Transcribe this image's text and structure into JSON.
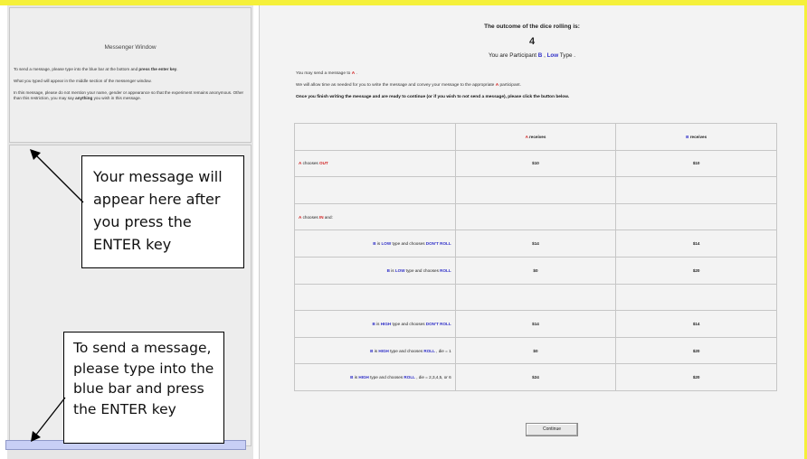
{
  "messenger": {
    "title": "Messenger Window",
    "line1_pre": "To send a message, please type into the blue bar at the bottom and ",
    "line1_bold": "press the enter key",
    "line1_post": ".",
    "line2": "What you typed will appear in the middle section of the messenger window.",
    "line3_pre": "In this message, please do not mention your name, gender or appearance so that the experiment remains anonymous. Other than this restriction, you may say ",
    "line3_bold": "anything",
    "line3_post": " you wish in this message.",
    "input_value": ""
  },
  "callouts": {
    "top_lines": [
      "Your message will",
      "appear here after",
      "you press the",
      "ENTER key"
    ],
    "bottom_lines": [
      "To send a message,",
      "please type into the",
      "blue bar and press",
      "the ENTER key"
    ]
  },
  "outcome": {
    "title": "The outcome of the dice rolling is:",
    "value": "4",
    "participant_pre": "You are Participant ",
    "participant_role": "B",
    "participant_sep": " , ",
    "participant_type": "Low",
    "participant_post": " Type ."
  },
  "instructions": {
    "line1_pre": "You may send a message to ",
    "line1_red": "A",
    "line1_post": " .",
    "line2_pre": "We will allow time as needed for you to write the message and convey your message to the appropriate ",
    "line2_red": "A",
    "line2_post": " participant.",
    "line3": "Once you finish writing the message and are ready to continue (or if you wish to not send a message), please click the button below."
  },
  "table": {
    "head": {
      "a_letter": "A",
      "a_rest": " receives",
      "b_letter": "B",
      "b_rest": " receives"
    },
    "rows": [
      {
        "l1": "A",
        "l1c": "red",
        "l2": " chooses ",
        "l3": "OUT",
        "l3c": "red",
        "l4": "",
        "l5": "",
        "l5c": "",
        "l6": "",
        "align": "left",
        "a": "$10",
        "b": "$10"
      },
      {
        "l1": "",
        "l1c": "",
        "l2": "",
        "l3": "",
        "l3c": "",
        "l4": "",
        "l5": "",
        "l5c": "",
        "l6": "",
        "align": "left",
        "a": "",
        "b": ""
      },
      {
        "l1": "A",
        "l1c": "red",
        "l2": " chooses ",
        "l3": "IN",
        "l3c": "red",
        "l4": " and:",
        "l5": "",
        "l5c": "",
        "l6": "",
        "align": "left",
        "a": "",
        "b": ""
      },
      {
        "l1": "B",
        "l1c": "blue",
        "l2": " is ",
        "l3": "LOW",
        "l3c": "blue",
        "l4": " type and chooses ",
        "l5": "DON'T ROLL",
        "l5c": "blue",
        "l6": "",
        "align": "right",
        "a": "$14",
        "b": "$14"
      },
      {
        "l1": "B",
        "l1c": "blue",
        "l2": " is ",
        "l3": "LOW",
        "l3c": "blue",
        "l4": " type and chooses ",
        "l5": "ROLL",
        "l5c": "blue",
        "l6": "",
        "align": "right",
        "a": "$0",
        "b": "$20"
      },
      {
        "l1": "",
        "l1c": "",
        "l2": "",
        "l3": "",
        "l3c": "",
        "l4": "",
        "l5": "",
        "l5c": "",
        "l6": "",
        "align": "right",
        "a": "",
        "b": ""
      },
      {
        "l1": "B",
        "l1c": "blue",
        "l2": " is ",
        "l3": "HIGH",
        "l3c": "blue",
        "l4": " type and chooses ",
        "l5": "DON'T ROLL",
        "l5c": "blue",
        "l6": "",
        "align": "right",
        "a": "$14",
        "b": "$14"
      },
      {
        "l1": "B",
        "l1c": "blue",
        "l2": " is ",
        "l3": "HIGH",
        "l3c": "blue",
        "l4": " type and chooses ",
        "l5": "ROLL",
        "l5c": "blue",
        "l6": " , die = 1",
        "align": "right",
        "a": "$0",
        "b": "$20"
      },
      {
        "l1": "B",
        "l1c": "blue",
        "l2": " is ",
        "l3": "HIGH",
        "l3c": "blue",
        "l4": " type and chooses ",
        "l5": "ROLL",
        "l5c": "blue",
        "l6": " , die = 2,3,4,5, or 6",
        "align": "right",
        "a": "$24",
        "b": "$20"
      }
    ]
  },
  "continue_label": "Continue",
  "colors": {
    "a_red": "#d02020",
    "b_blue": "#3030c8",
    "input_bar": "#c8cff5",
    "frame": "#f5f03a"
  },
  "icons": [
    "arrow-up-left-icon",
    "arrow-down-left-icon"
  ]
}
